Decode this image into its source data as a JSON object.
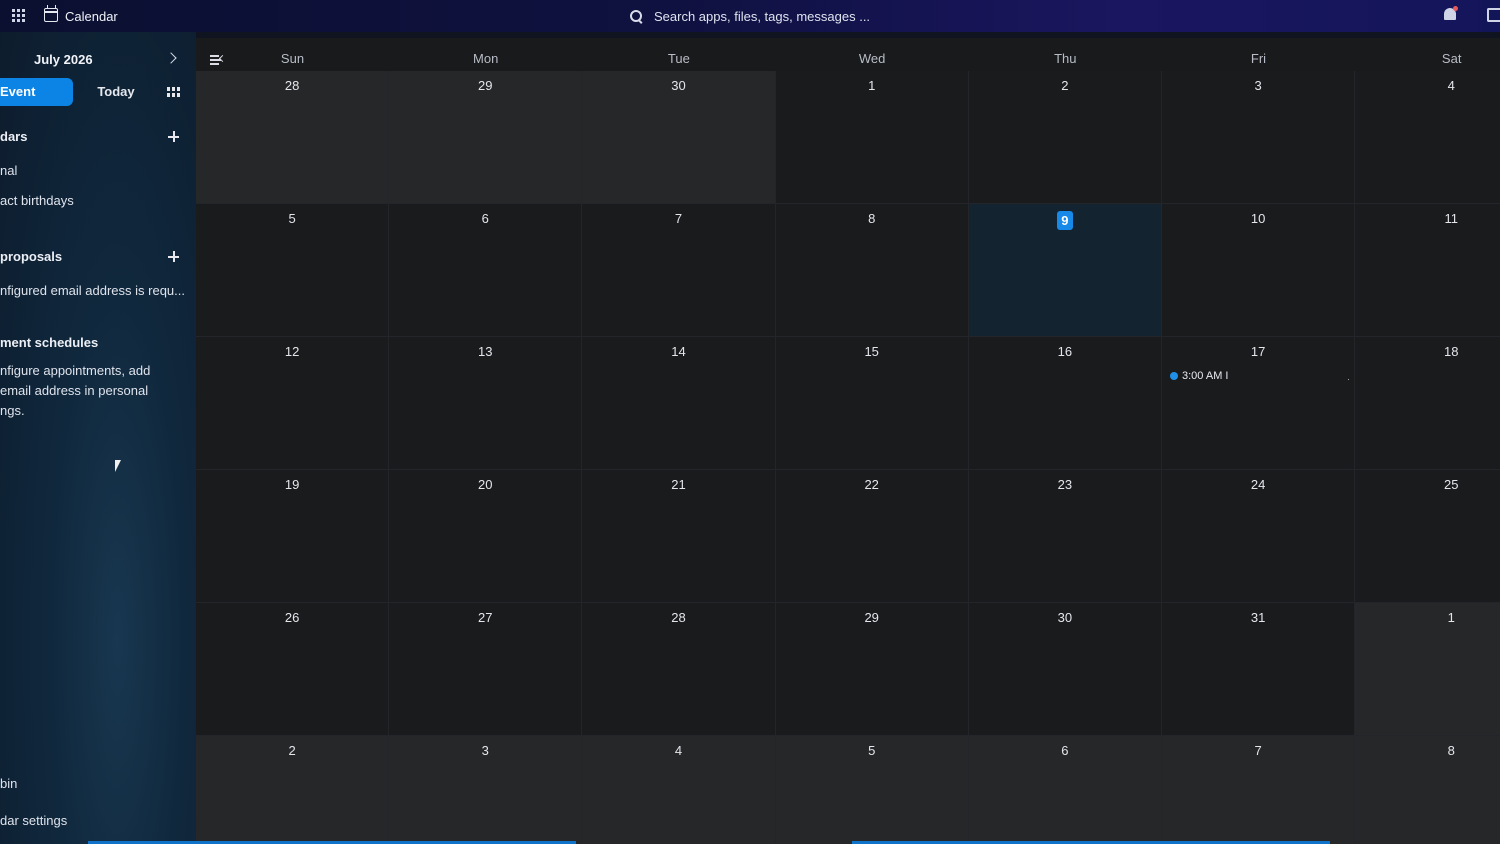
{
  "topbar": {
    "app_title": "Calendar",
    "search_placeholder": "Search apps, files, tags, messages ..."
  },
  "sidebar": {
    "month_label": "July 2026",
    "new_event_label": "Event",
    "today_label": "Today",
    "calendars_title": "dars",
    "calendars": [
      {
        "label": "nal"
      },
      {
        "label": "act birthdays"
      }
    ],
    "proposals_title": "proposals",
    "proposals_text": "nfigured email address is requ...",
    "schedules_title": "ment schedules",
    "schedules_text": "nfigure appointments, add email address in personal ngs.",
    "trash_label": "bin",
    "settings_label": "dar settings"
  },
  "calendar": {
    "weekdays": [
      "Sun",
      "Mon",
      "Tue",
      "Wed",
      "Thu",
      "Fri",
      "Sat"
    ],
    "today": "9",
    "weeks": [
      [
        "28",
        "29",
        "30",
        "1",
        "2",
        "3",
        "4"
      ],
      [
        "5",
        "6",
        "7",
        "8",
        "9",
        "10",
        "11"
      ],
      [
        "12",
        "13",
        "14",
        "15",
        "16",
        "17",
        "18"
      ],
      [
        "19",
        "20",
        "21",
        "22",
        "23",
        "24",
        "25"
      ],
      [
        "26",
        "27",
        "28",
        "29",
        "30",
        "31",
        "1"
      ],
      [
        "2",
        "3",
        "4",
        "5",
        "6",
        "7",
        "8"
      ]
    ],
    "events": [
      {
        "week": 2,
        "day": 5,
        "label": "3:00 AM I",
        "color": "#1f8fe8"
      }
    ]
  },
  "colors": {
    "accent": "#0b84e6",
    "today_badge": "#1789e8",
    "cell_bg": "#1a1b1d",
    "other_month_bg": "#262729"
  }
}
